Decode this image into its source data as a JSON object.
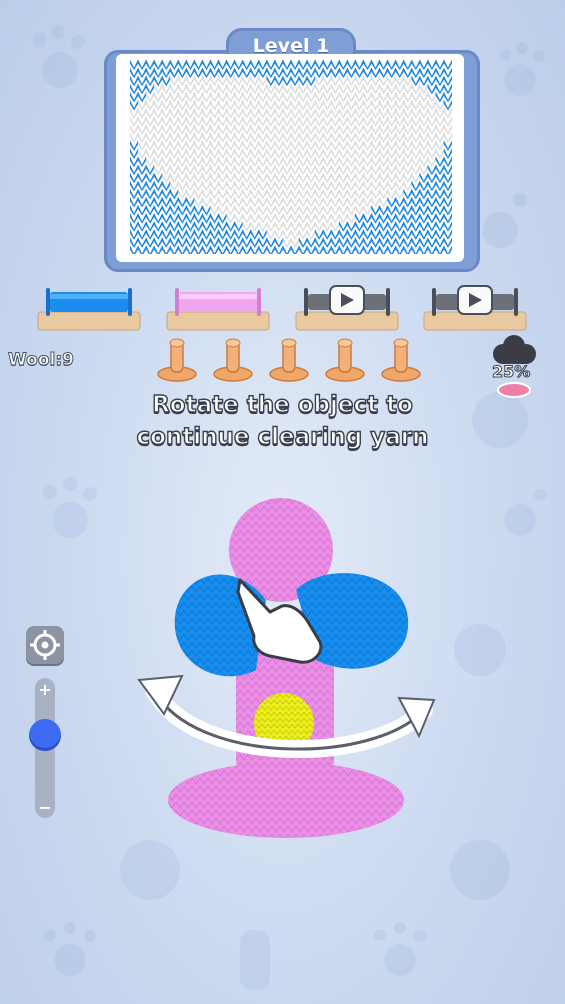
{
  "level": {
    "label": "Level 1"
  },
  "wool": {
    "label": "Wool:9"
  },
  "message": {
    "line1": "Rotate the object to",
    "line2": "continue clearing yarn"
  },
  "progress": {
    "percent_text": "25%",
    "percent": 25
  },
  "spools": [
    {
      "state": "filled",
      "color": "#1a8ef0"
    },
    {
      "state": "filled",
      "color": "#f0a6f0"
    },
    {
      "state": "locked-video",
      "icon": "play-icon"
    },
    {
      "state": "locked-video",
      "icon": "play-icon"
    }
  ],
  "pegs": {
    "count": 5
  },
  "zoom_slider": {
    "plus": "+",
    "minus": "−",
    "level": 0.45
  },
  "colors": {
    "pattern_blue": "#1a90f0",
    "pattern_white": "#e4e4e4",
    "object_pink": "#ea8ee6",
    "object_blue": "#158ef0",
    "object_yellow": "#eef01c"
  }
}
